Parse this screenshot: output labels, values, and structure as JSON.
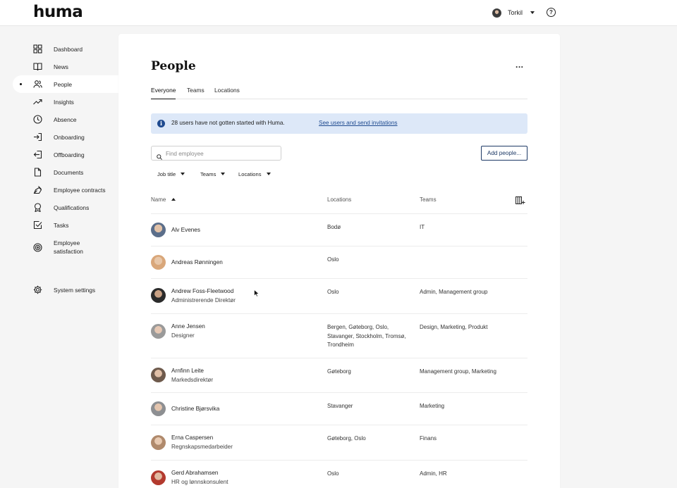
{
  "app": {
    "logo": "huma"
  },
  "user": {
    "name": "Torkil"
  },
  "help": {
    "label": "?"
  },
  "sidebar": {
    "items": [
      {
        "label": "Dashboard",
        "icon": "dashboard-icon"
      },
      {
        "label": "News",
        "icon": "book-icon"
      },
      {
        "label": "People",
        "icon": "people-icon",
        "active": true
      },
      {
        "label": "Insights",
        "icon": "trend-icon"
      },
      {
        "label": "Absence",
        "icon": "clock-icon"
      },
      {
        "label": "Onboarding",
        "icon": "sign-in-icon"
      },
      {
        "label": "Offboarding",
        "icon": "sign-out-icon"
      },
      {
        "label": "Documents",
        "icon": "document-icon"
      },
      {
        "label": "Employee contracts",
        "icon": "pen-icon"
      },
      {
        "label": "Qualifications",
        "icon": "badge-icon"
      },
      {
        "label": "Tasks",
        "icon": "checkbox-icon"
      },
      {
        "label": "Employee\nsatisfaction",
        "icon": "target-icon"
      }
    ],
    "settings": {
      "label": "System settings",
      "icon": "gear-icon"
    }
  },
  "page": {
    "title": "People",
    "more": "...",
    "tabs": [
      {
        "label": "Everyone",
        "active": true
      },
      {
        "label": "Teams",
        "active": false
      },
      {
        "label": "Locations",
        "active": false
      }
    ],
    "banner": {
      "text": "28 users have not gotten started with Huma.",
      "link": "See users and send invitations"
    },
    "search": {
      "placeholder": "Find employee",
      "value": ""
    },
    "add_button": "Add people...",
    "filters": [
      "Job title",
      "Teams",
      "Locations"
    ],
    "table": {
      "columns": {
        "name": "Name",
        "locations": "Locations",
        "teams": "Teams"
      },
      "rows": [
        {
          "name": "Alv Evenes",
          "title": "",
          "locations": "Bodø",
          "teams": "IT"
        },
        {
          "name": "Andreas Rønningen",
          "title": "",
          "locations": "Oslo",
          "teams": ""
        },
        {
          "name": "Andrew Foss-Fleetwood",
          "title": "Administrerende Direktør",
          "locations": "Oslo",
          "teams": "Admin, Management group"
        },
        {
          "name": "Anne Jensen",
          "title": "Designer",
          "locations": "Bergen, Gøteborg, Oslo, Stavanger, Stockholm, Tromsø, Trondheim",
          "teams": "Design, Marketing, Produkt"
        },
        {
          "name": "Arnfinn Leite",
          "title": "Markedsdirektør",
          "locations": "Gøteborg",
          "teams": "Management group, Marketing"
        },
        {
          "name": "Christine Bjørsvika",
          "title": "",
          "locations": "Stavanger",
          "teams": "Marketing"
        },
        {
          "name": "Erna Caspersen",
          "title": "Regnskapsmedarbeider",
          "locations": "Gøteborg, Oslo",
          "teams": "Finans"
        },
        {
          "name": "Gerd Abrahamsen",
          "title": "HR og lønnskonsulent",
          "locations": "Oslo",
          "teams": "Admin, HR"
        }
      ]
    }
  },
  "colors": {
    "accent": "#1e4a8f",
    "banner_bg": "#dde8f8",
    "page_bg": "#f5f5f5"
  }
}
